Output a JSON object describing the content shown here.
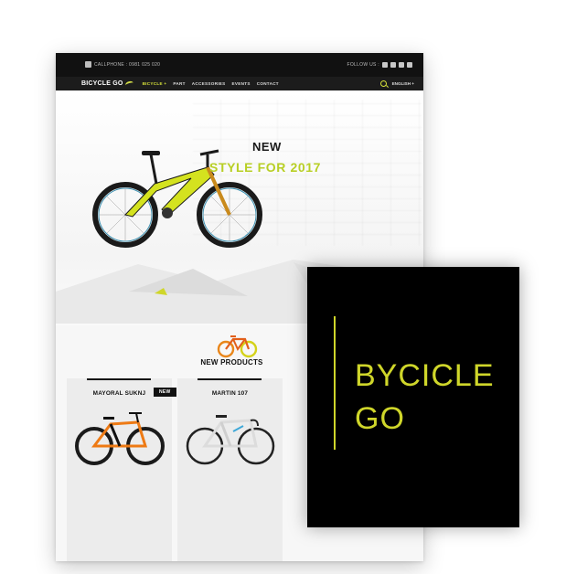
{
  "site": {
    "topbar": {
      "phone_text": "CALLPHONE : 0981 025 020",
      "follow_label": "FOLLOW US :",
      "social_icons": [
        "facebook-icon",
        "google-plus-icon",
        "instagram-icon",
        "twitter-icon"
      ]
    },
    "nav": {
      "logo": "BICYCLE GO",
      "items": [
        "BICYCLE +",
        "PART",
        "ACCESSORIES",
        "EVENTS",
        "CONTACT"
      ],
      "language": "ENGLISH +"
    },
    "hero": {
      "line1": "NEW",
      "line2": "STYLE FOR 2017",
      "prev_arrow": "←",
      "next_arrow": "→"
    },
    "new_products": {
      "title": "NEW PRODUCTS",
      "products": [
        {
          "name": "MAYORAL SUKNJ",
          "badge": "NEW"
        },
        {
          "name": "MARTIN 107"
        }
      ]
    }
  },
  "promo": {
    "line1": "BYCICLE",
    "line2": "GO"
  },
  "colors": {
    "accent": "#d8e33a",
    "dark": "#111111",
    "promo_bg": "#000000"
  }
}
